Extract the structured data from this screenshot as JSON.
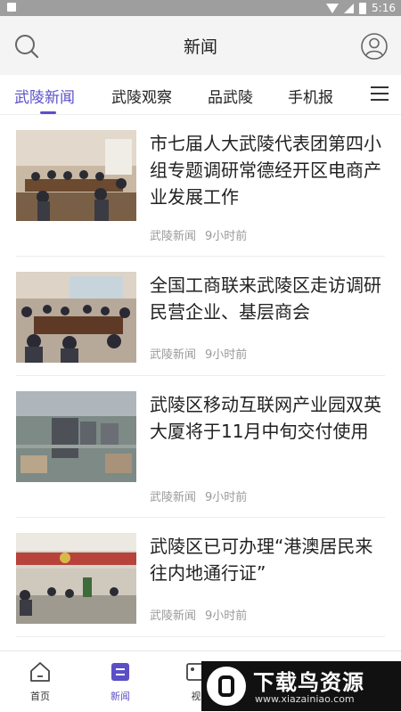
{
  "status_bar": {
    "time": "5:16"
  },
  "header": {
    "title": "新闻"
  },
  "tabs": [
    {
      "label": "武陵新闻",
      "active": true
    },
    {
      "label": "武陵观察",
      "active": false
    },
    {
      "label": "品武陵",
      "active": false
    },
    {
      "label": "手机报",
      "active": false
    }
  ],
  "news": [
    {
      "title": "市七届人大武陵代表团第四小组专题调研常德经开区电商产业发展工作",
      "source": "武陵新闻",
      "time": "9小时前"
    },
    {
      "title": "全国工商联来武陵区走访调研民营企业、基层商会",
      "source": "武陵新闻",
      "time": "9小时前"
    },
    {
      "title": "武陵区移动互联网产业园双英大厦将于11月中旬交付使用",
      "source": "武陵新闻",
      "time": "9小时前"
    },
    {
      "title": "武陵区已可办理“港澳居民来往内地通行证”",
      "source": "武陵新闻",
      "time": "9小时前"
    }
  ],
  "bottom_nav": [
    {
      "label": "首页",
      "active": false
    },
    {
      "label": "新闻",
      "active": true
    },
    {
      "label": "视",
      "active": false
    }
  ],
  "watermark": {
    "title": "下载鸟资源",
    "url": "www.xiazainiao.com"
  },
  "colors": {
    "accent": "#5b4fc7",
    "header_bg": "#f4f4f4",
    "meta_text": "#9a9a9a"
  }
}
